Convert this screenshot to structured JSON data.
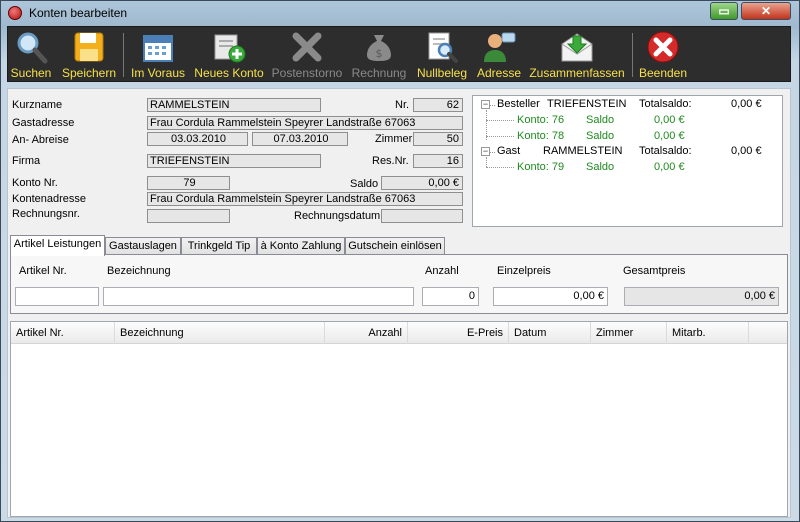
{
  "window": {
    "title": "Konten bearbeiten",
    "min_glyph": "▭",
    "close_glyph": "✕"
  },
  "toolbar": [
    {
      "label": "Suchen",
      "icon": "magnifier-icon",
      "enabled": true
    },
    {
      "label": "Speichern",
      "icon": "floppy-disk-icon",
      "enabled": true
    },
    {
      "label": "Im Voraus",
      "icon": "calendar-icon",
      "enabled": true
    },
    {
      "label": "Neues Konto",
      "icon": "new-account-icon",
      "enabled": true
    },
    {
      "label": "Postenstorno",
      "icon": "cancel-x-icon",
      "enabled": false
    },
    {
      "label": "Rechnung",
      "icon": "money-bag-icon",
      "enabled": false
    },
    {
      "label": "Nullbeleg",
      "icon": "document-search-icon",
      "enabled": true
    },
    {
      "label": "Adresse",
      "icon": "person-contact-icon",
      "enabled": true
    },
    {
      "label": "Zusammenfassen",
      "icon": "envelope-download-icon",
      "enabled": true
    },
    {
      "label": "Beenden",
      "icon": "exit-x-icon",
      "enabled": true
    }
  ],
  "form": {
    "kurzname_label": "Kurzname",
    "kurzname": "RAMMELSTEIN",
    "nr_label": "Nr.",
    "nr": "62",
    "gastadresse_label": "Gastadresse",
    "gastadresse": "Frau Cordula Rammelstein Speyrer Landstraße 67063",
    "anabreise_label": "An- Abreise",
    "anreise": "03.03.2010",
    "abreise": "07.03.2010",
    "zimmer_label": "Zimmer",
    "zimmer": "50",
    "firma_label": "Firma",
    "firma": "TRIEFENSTEIN",
    "resnr_label": "Res.Nr.",
    "resnr": "16",
    "konto_label": "Konto Nr.",
    "konto": "79",
    "saldo_label": "Saldo",
    "saldo": "0,00 €",
    "kontenadresse_label": "Kontenadresse",
    "kontenadresse": "Frau Cordula Rammelstein Speyrer Landstraße 67063",
    "rechnungsnr_label": "Rechnungsnr.",
    "rechnungsnr": "",
    "rechnungsdatum_label": "Rechnungsdatum",
    "rechnungsdatum": ""
  },
  "tree": {
    "besteller": {
      "role": "Besteller",
      "name": "TRIEFENSTEIN",
      "total_label": "Totalsaldo:",
      "total": "0,00 €",
      "konten": [
        {
          "label": "Konto: 76",
          "saldo_label": "Saldo",
          "saldo": "0,00 €"
        },
        {
          "label": "Konto: 78",
          "saldo_label": "Saldo",
          "saldo": "0,00 €"
        }
      ]
    },
    "gast": {
      "role": "Gast",
      "name": "RAMMELSTEIN",
      "total_label": "Totalsaldo:",
      "total": "0,00 €",
      "konten": [
        {
          "label": "Konto: 79",
          "saldo_label": "Saldo",
          "saldo": "0,00 €"
        }
      ]
    }
  },
  "tabs": [
    "Artikel Leistungen",
    "Gastauslagen",
    "Trinkgeld Tip",
    "à Konto Zahlung",
    "Gutschein einlösen"
  ],
  "entry": {
    "artikel_label": "Artikel Nr.",
    "artikel": "",
    "bezeichnung_label": "Bezeichnung",
    "bezeichnung": "",
    "anzahl_label": "Anzahl",
    "anzahl": "0",
    "einzelpreis_label": "Einzelpreis",
    "einzelpreis": "0,00 €",
    "gesamtpreis_label": "Gesamtpreis",
    "gesamtpreis": "0,00 €"
  },
  "grid": {
    "columns": [
      "Artikel Nr.",
      "Bezeichnung",
      "Anzahl",
      "E-Preis",
      "Datum",
      "Zimmer",
      "Mitarb."
    ]
  }
}
